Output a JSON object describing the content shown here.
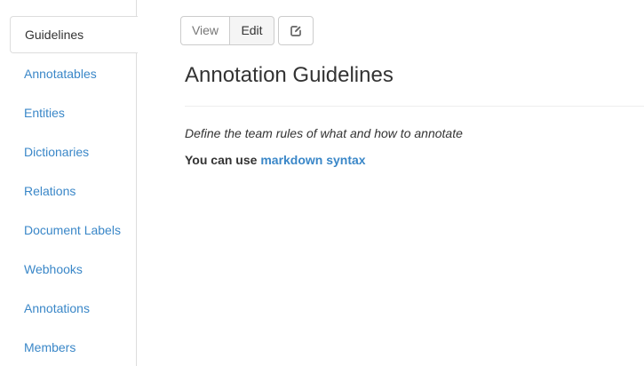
{
  "sidebar": {
    "items": [
      {
        "label": "Guidelines",
        "active": true
      },
      {
        "label": "Annotatables"
      },
      {
        "label": "Entities"
      },
      {
        "label": "Dictionaries"
      },
      {
        "label": "Relations"
      },
      {
        "label": "Document Labels"
      },
      {
        "label": "Webhooks"
      },
      {
        "label": "Annotations"
      },
      {
        "label": "Members"
      }
    ]
  },
  "toolbar": {
    "view_label": "View",
    "edit_label": "Edit",
    "edit_icon": "edit-square-icon"
  },
  "main": {
    "title": "Annotation Guidelines",
    "description": "Define the team rules of what and how to annotate",
    "markdown_prefix": "You can use ",
    "markdown_link": "markdown syntax"
  },
  "colors": {
    "link": "#3a87c8",
    "text": "#333333",
    "border": "#dddddd"
  }
}
